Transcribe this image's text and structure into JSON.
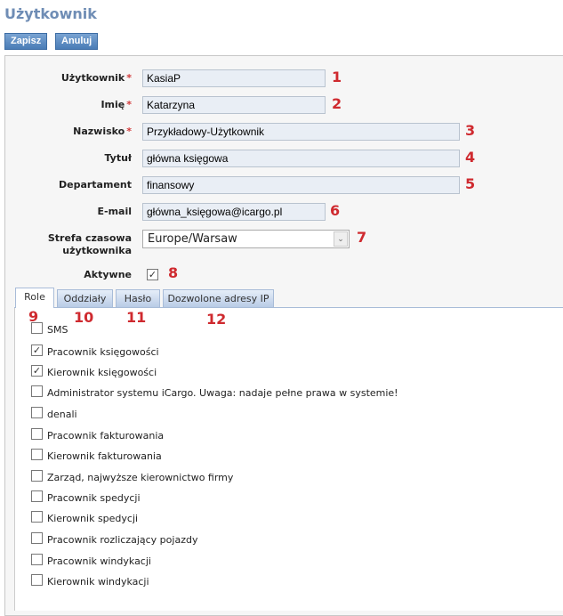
{
  "title": "Użytkownik",
  "toolbar": {
    "save_label": "Zapisz",
    "cancel_label": "Anuluj"
  },
  "form": {
    "username": {
      "label": "Użytkownik",
      "required": "*",
      "value": "KasiaP",
      "marker": "1"
    },
    "first_name": {
      "label": "Imię",
      "required": "*",
      "value": "Katarzyna",
      "marker": "2"
    },
    "last_name": {
      "label": "Nazwisko",
      "required": "*",
      "value": "Przykładowy-Użytkownik",
      "marker": "3"
    },
    "job_title": {
      "label": "Tytuł",
      "value": "główna księgowa",
      "marker": "4"
    },
    "department": {
      "label": "Departament",
      "value": "finansowy",
      "marker": "5"
    },
    "email": {
      "label": "E-mail",
      "value": "główna_księgowa@icargo.pl",
      "marker": "6"
    },
    "timezone": {
      "label_line1": "Strefa czasowa",
      "label_line2": "użytkownika",
      "value": "Europe/Warsaw",
      "marker": "7"
    },
    "active": {
      "label": "Aktywne",
      "checked": true,
      "marker": "8"
    }
  },
  "tabs": [
    {
      "label": "Role",
      "marker": "9",
      "active": true
    },
    {
      "label": "Oddziały",
      "marker": "10"
    },
    {
      "label": "Hasło",
      "marker": "11"
    },
    {
      "label": "Dozwolone adresy IP",
      "marker": "12"
    }
  ],
  "roles": [
    {
      "label": "SMS",
      "checked": false
    },
    {
      "label": "Pracownik księgowości",
      "checked": true
    },
    {
      "label": "Kierownik księgowości",
      "checked": true
    },
    {
      "label": "Administrator systemu iCargo. Uwaga: nadaje pełne prawa w systemie!",
      "checked": false
    },
    {
      "label": "denali",
      "checked": false
    },
    {
      "label": "Pracownik fakturowania",
      "checked": false
    },
    {
      "label": "Kierownik fakturowania",
      "checked": false
    },
    {
      "label": "Zarząd, najwyższe kierownictwo firmy",
      "checked": false
    },
    {
      "label": "Pracownik spedycji",
      "checked": false
    },
    {
      "label": "Kierownik spedycji",
      "checked": false
    },
    {
      "label": "Pracownik rozliczający pojazdy",
      "checked": false
    },
    {
      "label": "Pracownik windykacji",
      "checked": false
    },
    {
      "label": "Kierownik windykacji",
      "checked": false
    }
  ]
}
